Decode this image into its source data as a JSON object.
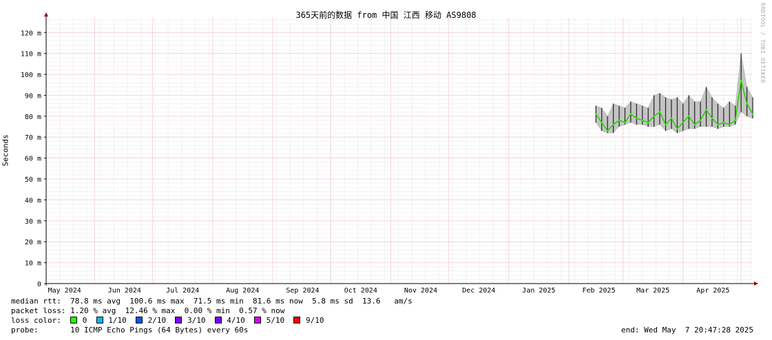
{
  "title": "365天前的数据 from 中国 江西 移动 AS9808",
  "side_label": "RRDTOOL / TOBI OETIKER",
  "chart_data": {
    "type": "line",
    "ylabel": "Seconds",
    "ylim": [
      0,
      0.127
    ],
    "yticks": [
      {
        "v": 0,
        "label": "0"
      },
      {
        "v": 0.01,
        "label": "10 m"
      },
      {
        "v": 0.02,
        "label": "20 m"
      },
      {
        "v": 0.03,
        "label": "30 m"
      },
      {
        "v": 0.04,
        "label": "40 m"
      },
      {
        "v": 0.05,
        "label": "50 m"
      },
      {
        "v": 0.06,
        "label": "60 m"
      },
      {
        "v": 0.07,
        "label": "70 m"
      },
      {
        "v": 0.08,
        "label": "80 m"
      },
      {
        "v": 0.09,
        "label": "90 m"
      },
      {
        "v": 0.1,
        "label": "100 m"
      },
      {
        "v": 0.11,
        "label": "110 m"
      },
      {
        "v": 0.12,
        "label": "120 m"
      }
    ],
    "xlim": [
      "2024-05-07",
      "2025-05-07"
    ],
    "xticks": [
      {
        "date": "2024-05-01",
        "label": "May 2024"
      },
      {
        "date": "2024-06-01",
        "label": "Jun 2024"
      },
      {
        "date": "2024-07-01",
        "label": "Jul 2024"
      },
      {
        "date": "2024-08-01",
        "label": "Aug 2024"
      },
      {
        "date": "2024-09-01",
        "label": "Sep 2024"
      },
      {
        "date": "2024-10-01",
        "label": "Oct 2024"
      },
      {
        "date": "2024-11-01",
        "label": "Nov 2024"
      },
      {
        "date": "2024-12-01",
        "label": "Dec 2024"
      },
      {
        "date": "2025-01-01",
        "label": "Jan 2025"
      },
      {
        "date": "2025-02-01",
        "label": "Feb 2025"
      },
      {
        "date": "2025-03-01",
        "label": "Mar 2025"
      },
      {
        "date": "2025-04-01",
        "label": "Apr 2025"
      },
      {
        "date": "2025-05-01",
        "label": ""
      }
    ],
    "grid": true,
    "series": [
      {
        "color": "#000000",
        "x": [
          "2025-02-15",
          "2025-02-18",
          "2025-02-21",
          "2025-02-24",
          "2025-02-27",
          "2025-03-02",
          "2025-03-05",
          "2025-03-08",
          "2025-03-11",
          "2025-03-14",
          "2025-03-17",
          "2025-03-20",
          "2025-03-23",
          "2025-03-26",
          "2025-03-29",
          "2025-04-01",
          "2025-04-04",
          "2025-04-07",
          "2025-04-10",
          "2025-04-13",
          "2025-04-16",
          "2025-04-19",
          "2025-04-22",
          "2025-04-25",
          "2025-04-28",
          "2025-05-01",
          "2025-05-04",
          "2025-05-07"
        ],
        "median": [
          0.081,
          0.077,
          0.073,
          0.076,
          0.078,
          0.077,
          0.081,
          0.079,
          0.078,
          0.077,
          0.08,
          0.082,
          0.076,
          0.079,
          0.074,
          0.077,
          0.08,
          0.076,
          0.078,
          0.083,
          0.079,
          0.076,
          0.077,
          0.076,
          0.078,
          0.097,
          0.086,
          0.081
        ],
        "max": [
          0.085,
          0.084,
          0.08,
          0.086,
          0.085,
          0.084,
          0.087,
          0.086,
          0.085,
          0.084,
          0.09,
          0.091,
          0.089,
          0.088,
          0.089,
          0.086,
          0.09,
          0.087,
          0.087,
          0.094,
          0.089,
          0.086,
          0.084,
          0.087,
          0.085,
          0.11,
          0.094,
          0.089
        ],
        "min": [
          0.077,
          0.073,
          0.072,
          0.072,
          0.075,
          0.076,
          0.077,
          0.076,
          0.076,
          0.075,
          0.075,
          0.076,
          0.073,
          0.074,
          0.072,
          0.073,
          0.074,
          0.074,
          0.075,
          0.075,
          0.075,
          0.074,
          0.075,
          0.075,
          0.076,
          0.082,
          0.08,
          0.079
        ]
      }
    ]
  },
  "legend": {
    "rtt_label": "median rtt:",
    "rtt_values": "78.8 ms avg  100.6 ms max  71.5 ms min  81.6 ms now  5.8 ms sd  13.6   am/s",
    "loss_label": "packet loss:",
    "loss_values": "1.20 % avg  12.46 % max  0.00 % min  0.57 % now",
    "color_label": "loss color:",
    "colors": [
      {
        "label": "0",
        "color": "#26ff00"
      },
      {
        "label": "1/10",
        "color": "#00b8ff"
      },
      {
        "label": "2/10",
        "color": "#0059ff"
      },
      {
        "label": "3/10",
        "color": "#7e00ff"
      },
      {
        "label": "4/10",
        "color": "#7e00ff"
      },
      {
        "label": "5/10",
        "color": "#dd00ff"
      },
      {
        "label": "9/10",
        "color": "#ff0000"
      }
    ],
    "probe_label": "probe:",
    "probe_values": "10 ICMP Echo Pings (64 Bytes) every 60s",
    "end_text": "end: Wed May  7 20:47:28 2025"
  }
}
